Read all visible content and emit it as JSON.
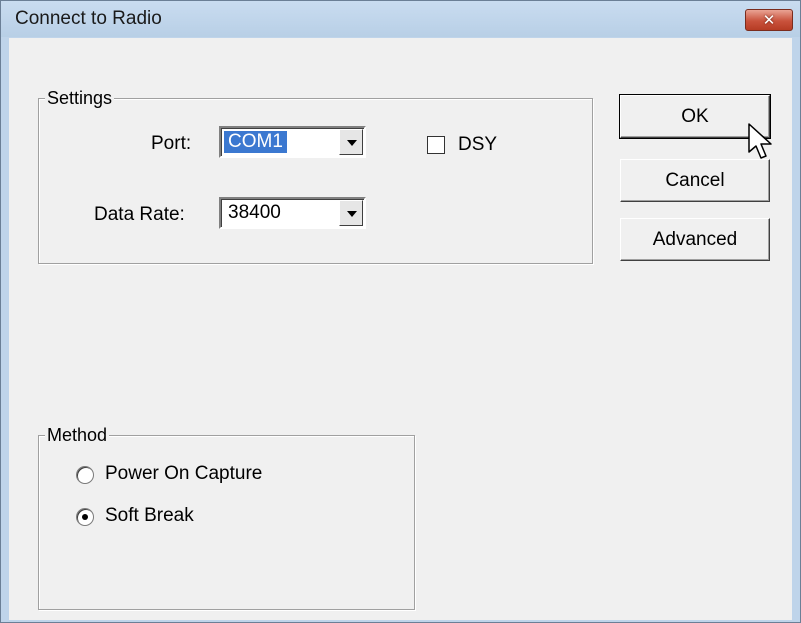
{
  "window": {
    "title": "Connect to Radio",
    "close_glyph": "✕"
  },
  "settings": {
    "legend": "Settings",
    "port_label": "Port:",
    "port_value": "COM1",
    "dsy_label": "DSY",
    "dsy_checked": false,
    "rate_label": "Data Rate:",
    "rate_value": "38400"
  },
  "buttons": {
    "ok": "OK",
    "cancel": "Cancel",
    "advanced": "Advanced"
  },
  "method": {
    "legend": "Method",
    "options": [
      {
        "label": "Power On Capture",
        "selected": false
      },
      {
        "label": "Soft Break",
        "selected": true
      }
    ]
  },
  "icons": {
    "close": "close-icon",
    "combo_arrow": "chevron-down-icon",
    "cursor": "mouse-pointer-icon"
  },
  "colors": {
    "selection": "#3b78d0",
    "close_button": "#c9523c",
    "titlebar": "#bfd4ea"
  }
}
